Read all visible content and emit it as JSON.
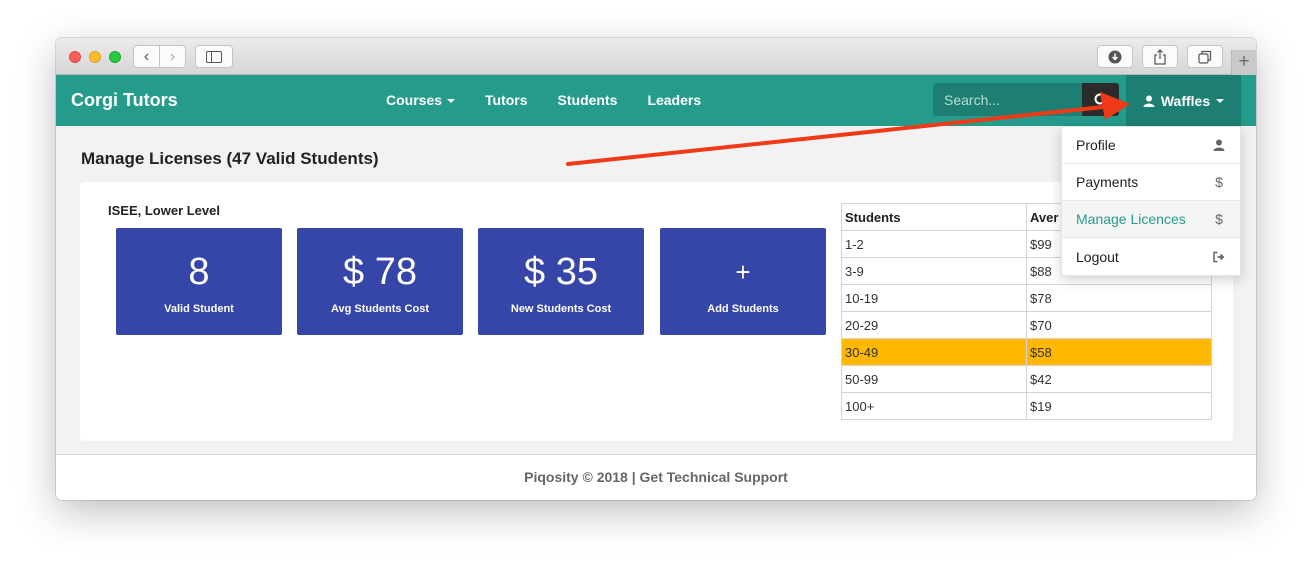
{
  "navbar": {
    "brand": "Corgi Tutors",
    "menu": [
      {
        "label": "Courses",
        "has_caret": true
      },
      {
        "label": "Tutors"
      },
      {
        "label": "Students"
      },
      {
        "label": "Leaders"
      }
    ],
    "search_placeholder": "Search...",
    "user_label": "Waffles"
  },
  "dropdown": {
    "items": [
      {
        "label": "Profile",
        "icon": "user-icon"
      },
      {
        "label": "Payments",
        "icon": "dollar-icon"
      },
      {
        "label": "Manage Licences",
        "icon": "dollar-icon",
        "active": true
      },
      {
        "label": "Logout",
        "icon": "sign-out-icon"
      }
    ],
    "dollar_glyph": "$"
  },
  "page": {
    "title": "Manage Licenses (47 Valid Students)",
    "section_title": "ISEE, Lower Level",
    "cards": [
      {
        "value": "8",
        "label": "Valid Student"
      },
      {
        "value": "$ 78",
        "label": "Avg Students Cost"
      },
      {
        "value": "$ 35",
        "label": "New Students Cost"
      },
      {
        "value": "+",
        "label": "Add Students"
      }
    ],
    "table": {
      "headers": [
        "Students",
        "Aver"
      ],
      "rows": [
        [
          "1-2",
          "$99"
        ],
        [
          "3-9",
          "$88"
        ],
        [
          "10-19",
          "$78"
        ],
        [
          "20-29",
          "$70"
        ],
        [
          "30-49",
          "$58"
        ],
        [
          "50-99",
          "$42"
        ],
        [
          "100+",
          "$19"
        ]
      ],
      "highlight_row": 4,
      "highlight_color": "#ffb800"
    }
  },
  "footer": {
    "text": "Piqosity © 2018 | Get Technical Support"
  },
  "colors": {
    "accent": "#249b8b",
    "card": "#3645a8",
    "annotation_arrow": "#f03a17"
  }
}
